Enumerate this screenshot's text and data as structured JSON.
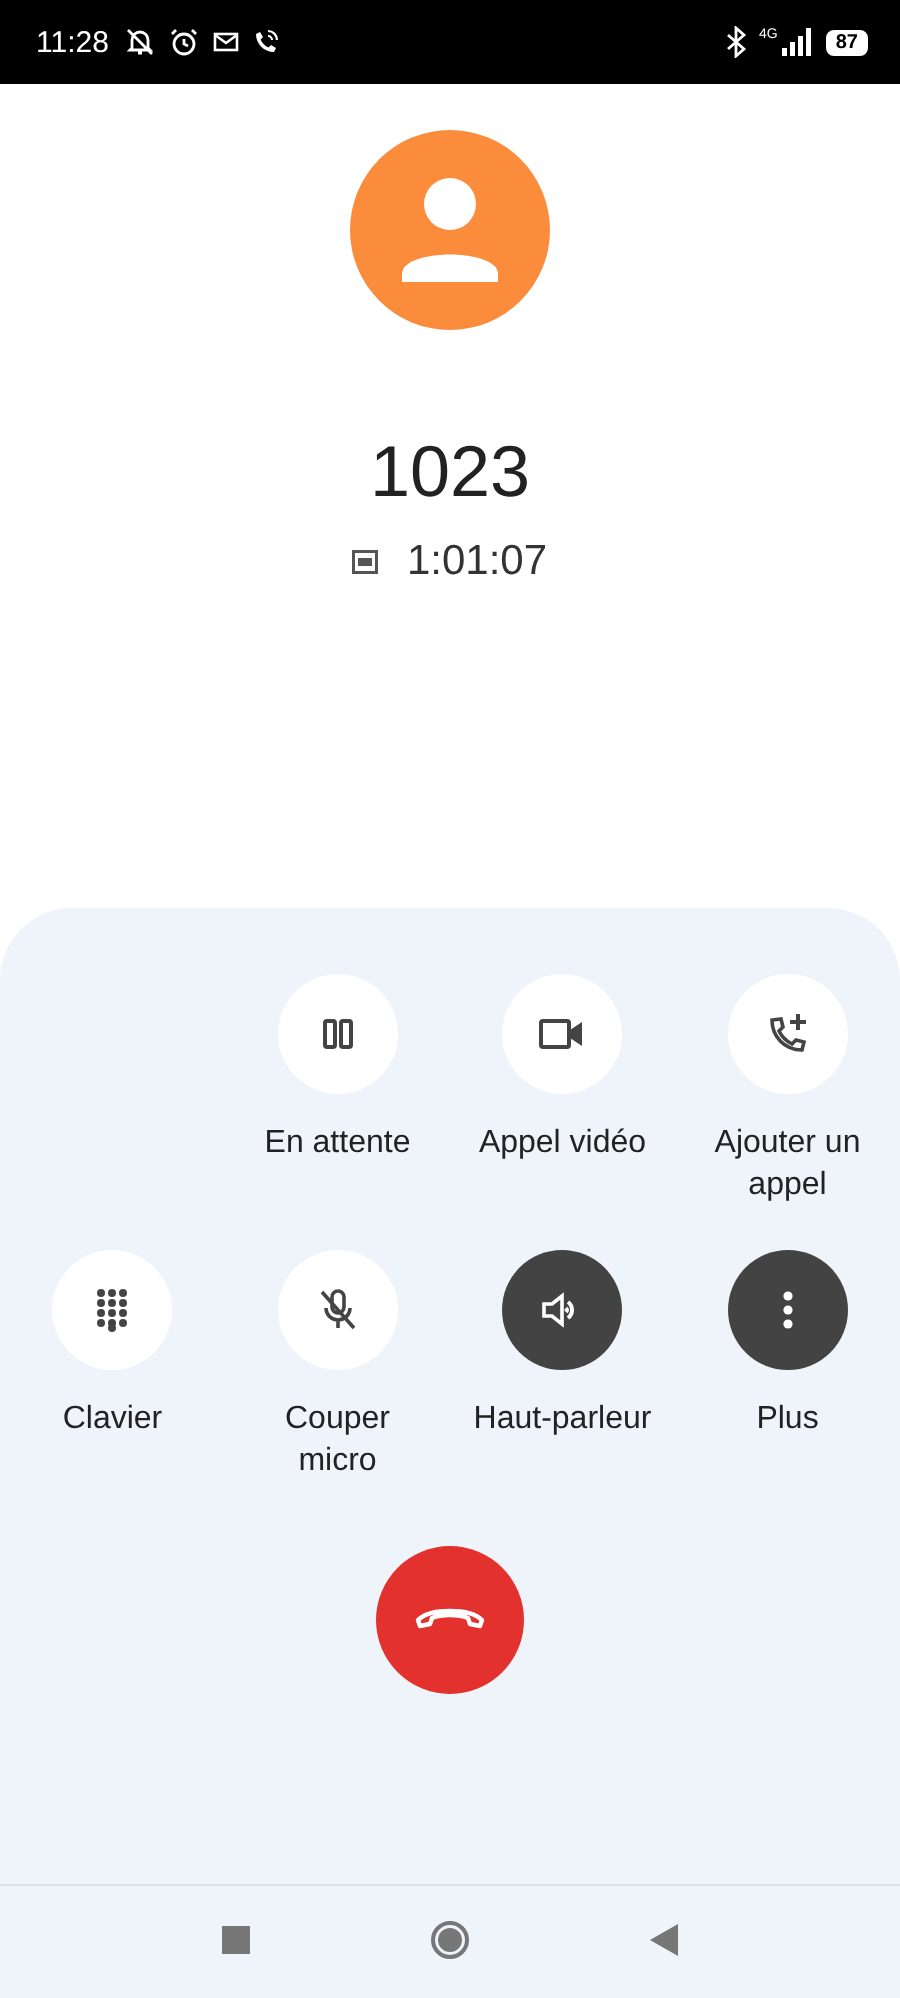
{
  "status_bar": {
    "time": "11:28",
    "network": "4G",
    "battery": "87"
  },
  "caller": {
    "number": "1023",
    "duration": "1:01:07"
  },
  "controls": [
    [
      {
        "kind": "hold",
        "label": "En attente",
        "on": false
      },
      {
        "kind": "video",
        "label": "Appel vidéo",
        "on": false
      },
      {
        "kind": "add-call",
        "label": "Ajouter un appel",
        "on": false
      }
    ],
    [
      {
        "kind": "keypad",
        "label": "Clavier",
        "on": false
      },
      {
        "kind": "mute",
        "label": "Couper micro",
        "on": false
      },
      {
        "kind": "speaker",
        "label": "Haut-parleur",
        "on": true
      },
      {
        "kind": "more",
        "label": "Plus",
        "on": true
      }
    ]
  ]
}
